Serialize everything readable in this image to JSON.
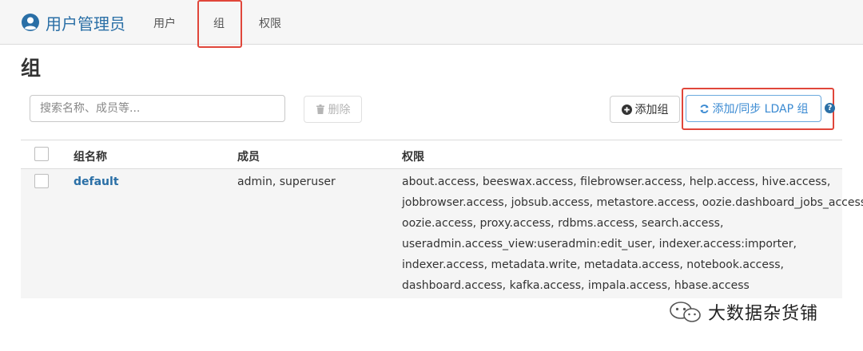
{
  "header": {
    "app_title": "用户管理员",
    "nav": [
      {
        "label": "用户"
      },
      {
        "label": "组"
      },
      {
        "label": "权限"
      }
    ]
  },
  "page": {
    "title": "组"
  },
  "toolbar": {
    "search_placeholder": "搜索名称、成员等...",
    "delete_label": "删除",
    "add_label": "添加组",
    "ldap_label": "添加/同步 LDAP 组",
    "help_glyph": "?"
  },
  "table": {
    "columns": [
      "组名称",
      "成员",
      "权限"
    ],
    "rows": [
      {
        "name": "default",
        "members": "admin, superuser",
        "permissions": [
          "about.access, beeswax.access, filebrowser.access, help.access, hive.access,",
          "jobbrowser.access, jobsub.access, metastore.access, oozie.dashboard_jobs_access,",
          "oozie.access, proxy.access, rdbms.access, search.access,",
          "useradmin.access_view:useradmin:edit_user, indexer.access:importer,",
          "indexer.access, metadata.write, metadata.access, notebook.access,",
          "dashboard.access, kafka.access, impala.access, hbase.access"
        ]
      }
    ]
  },
  "watermark": {
    "text": "大数据杂货铺"
  },
  "colors": {
    "brand": "#2a6fa6",
    "highlight": "#e0463a",
    "ldap_button": "#3a8ad2"
  }
}
